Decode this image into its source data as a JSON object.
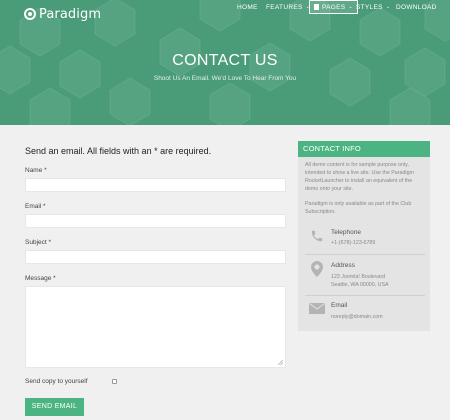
{
  "nav": {
    "logo": "Paradigm",
    "items": [
      {
        "label": "HOME",
        "chevron": false,
        "active": false
      },
      {
        "label": "FEATURES",
        "chevron": true,
        "active": false
      },
      {
        "label": "PAGES",
        "chevron": true,
        "active": true
      },
      {
        "label": "STYLES",
        "chevron": true,
        "active": false
      },
      {
        "label": "DOWNLOAD",
        "chevron": false,
        "active": false
      }
    ]
  },
  "hero": {
    "title": "CONTACT US",
    "subtitle": "Shoot Us An Email. We'd Love To Hear From You"
  },
  "form": {
    "title": "Send an email. All fields with an * are required.",
    "name_label": "Name *",
    "email_label": "Email *",
    "subject_label": "Subject *",
    "message_label": "Message *",
    "copy_label": "Send copy to yourself",
    "submit_label": "SEND EMAIL"
  },
  "contact": {
    "heading": "CONTACT INFO",
    "intro": "All demo content is for sample purpose only, intended to show a live site. Use the Paradigm RocketLauncher to install an equivalent of the demo onto your site.",
    "note": "Paradigm is only available as part of the Club Subscription.",
    "telephone_title": "Telephone",
    "telephone_value": "+1-(678)-123-6789",
    "address_title": "Address",
    "address_line1": "123 Joomla! Boulevard",
    "address_line2": "Seattle, WA 00000, USA",
    "email_title": "Email",
    "email_value": "noreply@domain.com"
  },
  "colors": {
    "hero": "#4a9c78",
    "accent": "#4cb482",
    "panel": "#e4e4e4"
  },
  "icons": [
    "logo-icon",
    "document-icon",
    "chevron-down-icon",
    "phone-icon",
    "map-pin-icon",
    "envelope-icon",
    "resize-handle-icon"
  ]
}
